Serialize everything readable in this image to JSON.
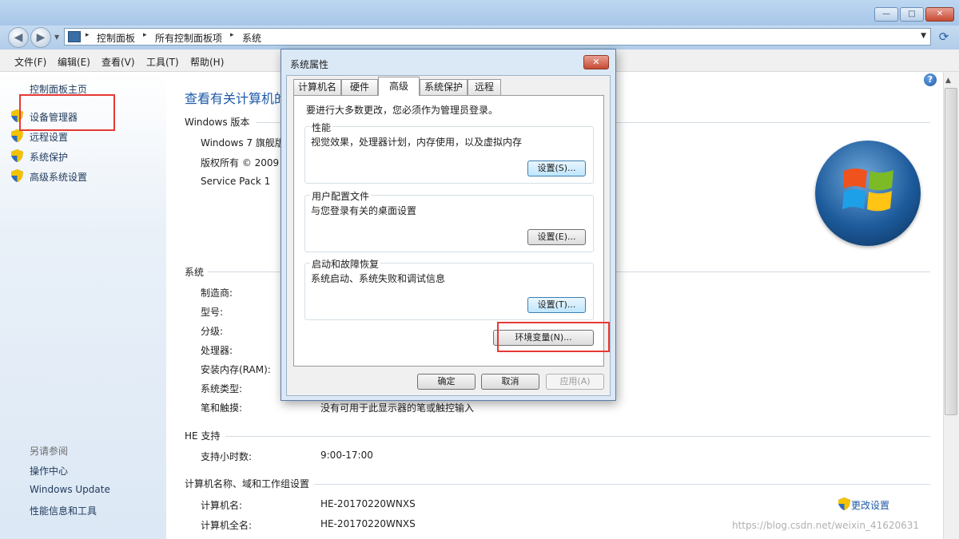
{
  "window": {
    "controls": {
      "minimize": "—",
      "maximize": "□",
      "close": "✕"
    }
  },
  "address_bar": {
    "crumbs": [
      "控制面板",
      "所有控制面板项",
      "系统"
    ],
    "separator": "▸"
  },
  "menu": [
    "文件(F)",
    "编辑(E)",
    "查看(V)",
    "工具(T)",
    "帮助(H)"
  ],
  "left_pane": {
    "home": "控制面板主页",
    "links": [
      "设备管理器",
      "远程设置",
      "系统保护",
      "高级系统设置"
    ],
    "see_also_title": "另请参阅",
    "see_also": [
      "操作中心",
      "Windows Update",
      "性能信息和工具"
    ]
  },
  "main": {
    "title": "查看有关计算机的",
    "edition_header": "Windows 版本",
    "edition_lines": [
      "Windows 7 旗舰版",
      "版权所有 © 2009",
      "Service Pack 1"
    ],
    "system_header": "系统",
    "system_rows": [
      {
        "label": "制造商:",
        "value": ""
      },
      {
        "label": "型号:",
        "value": ""
      },
      {
        "label": "分级:",
        "value": ""
      },
      {
        "label": "处理器:",
        "value": ""
      },
      {
        "label": "安装内存(RAM):",
        "value": ""
      },
      {
        "label": "系统类型:",
        "value": ""
      },
      {
        "label": "笔和触摸:",
        "value": "没有可用于此显示器的笔或触控输入"
      }
    ],
    "support_header": "HE 支持",
    "support_rows": [
      {
        "label": "支持小时数:",
        "value": "9:00-17:00"
      }
    ],
    "computer_header": "计算机名称、域和工作组设置",
    "computer_rows": [
      {
        "label": "计算机名:",
        "value": "HE-20170220WNXS"
      },
      {
        "label": "计算机全名:",
        "value": "HE-20170220WNXS"
      }
    ],
    "change_settings": "更改设置"
  },
  "dialog": {
    "title": "系统属性",
    "close": "✕",
    "tabs": [
      {
        "label": "计算机名",
        "active": false
      },
      {
        "label": "硬件",
        "active": false
      },
      {
        "label": "高级",
        "active": true
      },
      {
        "label": "系统保护",
        "active": false
      },
      {
        "label": "远程",
        "active": false
      }
    ],
    "admin_note": "要进行大多数更改，您必须作为管理员登录。",
    "groups": [
      {
        "title": "性能",
        "desc": "视觉效果，处理器计划，内存使用，以及虚拟内存",
        "button": "设置(S)..."
      },
      {
        "title": "用户配置文件",
        "desc": "与您登录有关的桌面设置",
        "button": "设置(E)..."
      },
      {
        "title": "启动和故障恢复",
        "desc": "系统启动、系统失败和调试信息",
        "button": "设置(T)..."
      }
    ],
    "env_button": "环境变量(N)...",
    "ok": "确定",
    "cancel": "取消",
    "apply": "应用(A)"
  },
  "watermark": "https://blog.csdn.net/weixin_41620631",
  "colors": {
    "link": "#1e5aa8",
    "highlight_box": "#e53935",
    "titlebar": "#a7c6e8"
  }
}
